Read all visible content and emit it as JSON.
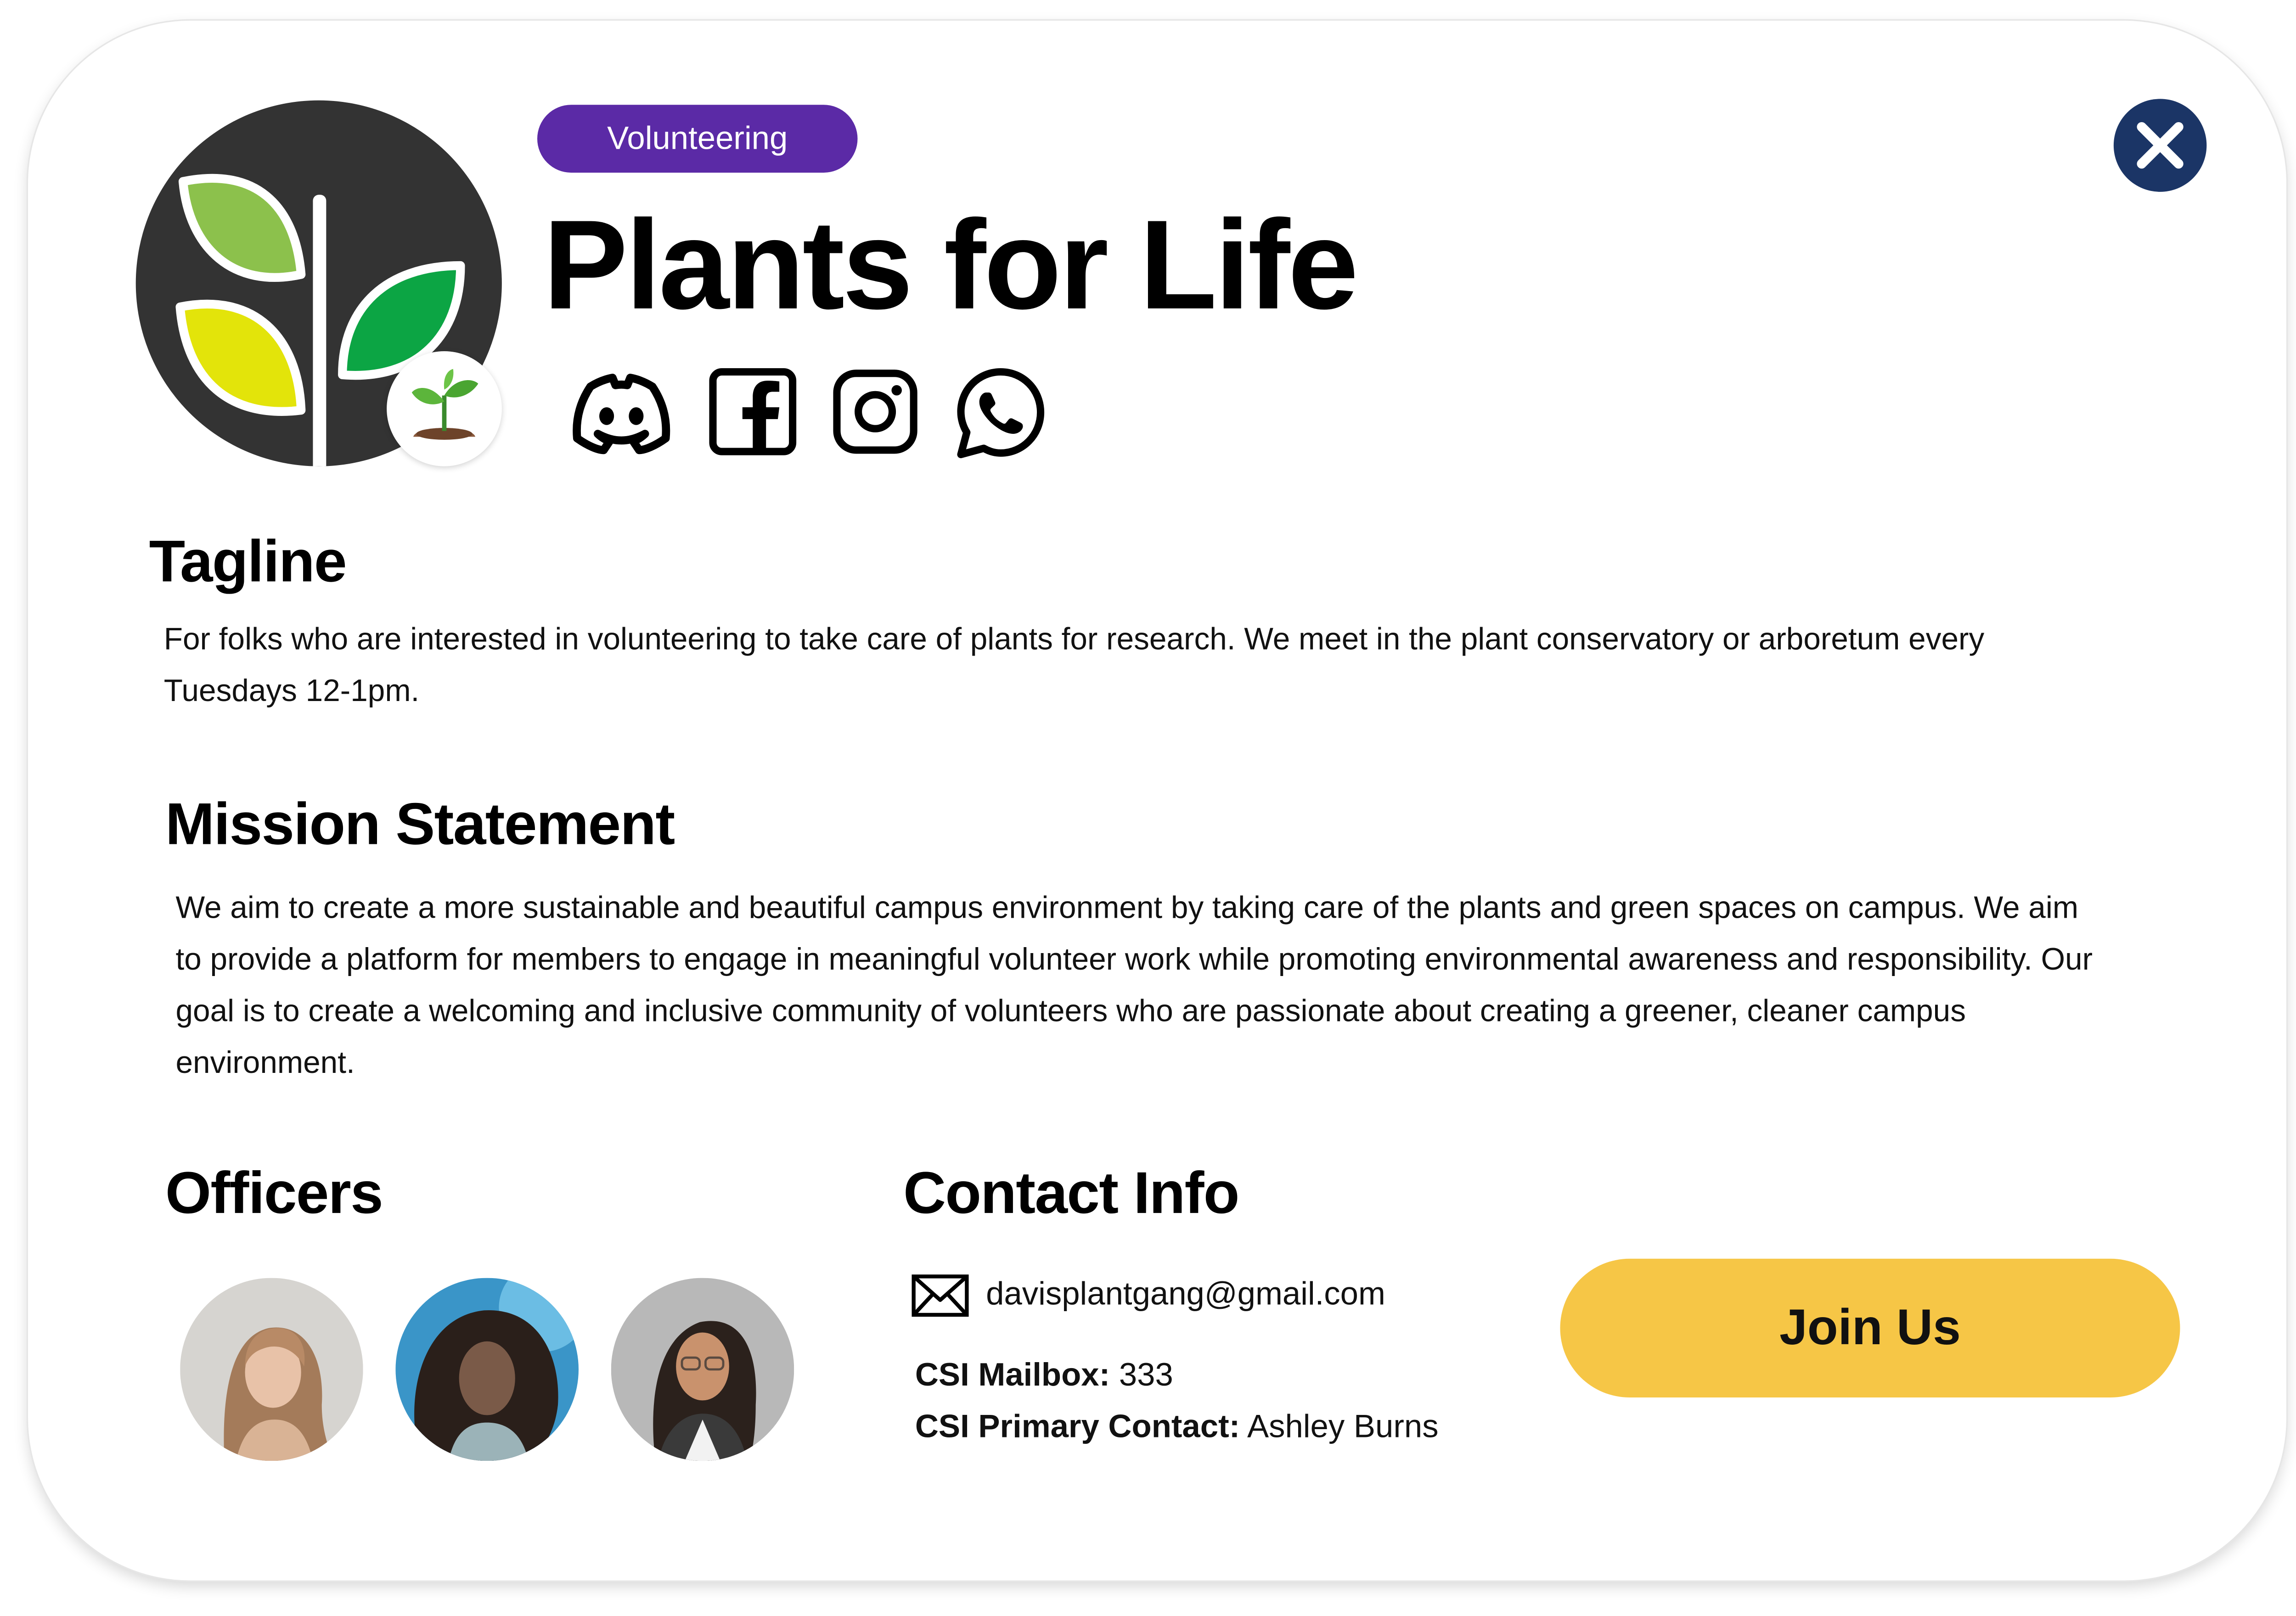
{
  "club": {
    "category": "Volunteering",
    "name": "Plants for Life",
    "category_color": "#5b2aa6"
  },
  "social_icons": [
    "discord-icon",
    "facebook-icon",
    "instagram-icon",
    "whatsapp-icon"
  ],
  "badge_icon": "seedling-icon",
  "close_icon": "close-icon",
  "tagline": {
    "heading": "Tagline",
    "text": "For folks who are interested in volunteering to take care of plants for research. We meet in the plant conservatory or arboretum every Tuesdays 12-1pm."
  },
  "mission": {
    "heading": "Mission Statement",
    "text": "We aim to create a more sustainable and beautiful campus environment by taking care of the plants and green spaces on campus. We aim to provide a platform for members to engage in meaningful volunteer work while promoting environmental awareness and responsibility. Our goal is to create a welcoming and inclusive community of volunteers who are passionate about creating a greener, cleaner campus environment."
  },
  "officers": {
    "heading": "Officers",
    "count": 3
  },
  "contact": {
    "heading": "Contact Info",
    "email": "davisplantgang@gmail.com",
    "mailbox_label": "CSI Mailbox:",
    "mailbox_value": " 333",
    "primary_label": "CSI Primary Contact:",
    "primary_value": " Ashley Burns"
  },
  "join_button": {
    "label": "Join Us",
    "color": "#f6c646"
  },
  "colors": {
    "close_button": "#1b3566",
    "logo_bg": "#333333"
  }
}
